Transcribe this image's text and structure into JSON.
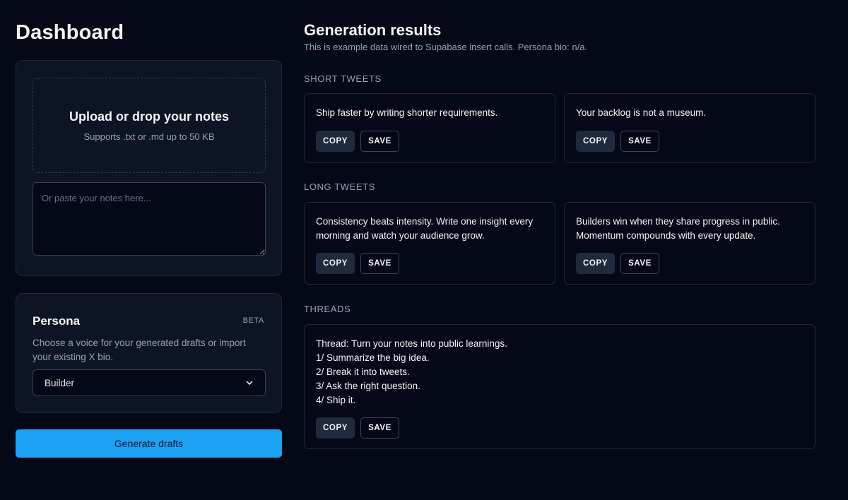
{
  "dashboard": {
    "title": "Dashboard"
  },
  "upload": {
    "title": "Upload or drop your notes",
    "subtitle": "Supports .txt or .md up to 50 KB",
    "paste_placeholder": "Or paste your notes here..."
  },
  "persona": {
    "title": "Persona",
    "badge": "BETA",
    "description": "Choose a voice for your generated drafts or import your existing X bio.",
    "selected": "Builder"
  },
  "generate_label": "Generate drafts",
  "results": {
    "title": "Generation results",
    "subtitle": "This is example data wired to Supabase insert calls. Persona bio: n/a.",
    "copy_label": "COPY",
    "save_label": "SAVE",
    "short": {
      "label": "SHORT TWEETS",
      "items": [
        "Ship faster by writing shorter requirements.",
        "Your backlog is not a museum."
      ]
    },
    "long": {
      "label": "LONG TWEETS",
      "items": [
        "Consistency beats intensity. Write one insight every morning and watch your audience grow.",
        "Builders win when they share progress in public. Momentum compounds with every update."
      ]
    },
    "threads": {
      "label": "THREADS",
      "lines": [
        "Thread: Turn your notes into public learnings.",
        "1/ Summarize the big idea.",
        "2/ Break it into tweets.",
        "3/ Ask the right question.",
        "4/ Ship it."
      ]
    }
  },
  "colors": {
    "background": "#050816",
    "card": "#0d1424",
    "accent": "#1da1f2",
    "muted_text": "#94a3b8"
  },
  "icons": {
    "select_chevron": "chevron-down-icon"
  }
}
